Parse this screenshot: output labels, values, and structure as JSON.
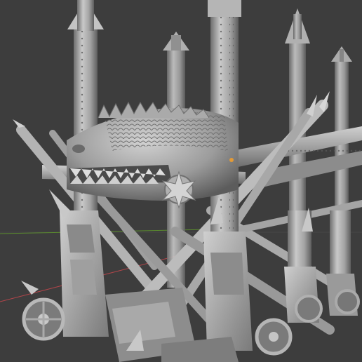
{
  "viewport": {
    "background": "#3d3d3d",
    "grid_line_color": "#474747",
    "x_axis_color": "#b1454a",
    "y_axis_color": "#5a8a2e",
    "origin_marker_color": "#e39a36"
  },
  "model": {
    "base_color": "#9a9a9a",
    "light_color": "#cfcfcf",
    "dark_color": "#5f5f5f"
  }
}
